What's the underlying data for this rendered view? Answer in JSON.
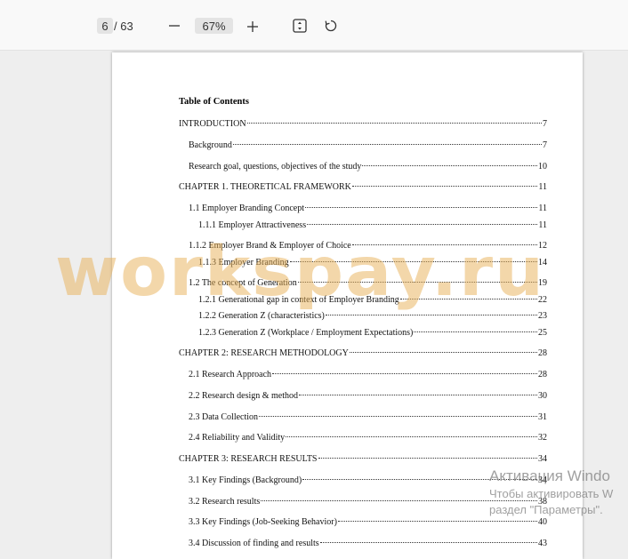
{
  "toolbar": {
    "page_current": "6",
    "page_total": "/ 63",
    "zoom": "67%",
    "icons": [
      "minus-icon",
      "plus-icon",
      "fit-page-icon",
      "rotate-icon"
    ]
  },
  "document": {
    "toc_title": "Table of Contents",
    "entries": [
      {
        "text": "INTRODUCTION",
        "page": "7"
      },
      {
        "text": "Background",
        "page": "7"
      },
      {
        "text": "Research goal, questions, objectives of the study",
        "page": "10"
      },
      {
        "text": "CHAPTER 1. THEORETICAL FRAMEWORK",
        "page": "11"
      },
      {
        "text": "1.1 Employer Branding Concept",
        "page": "11"
      },
      {
        "text": "1.1.1 Employer Attractiveness",
        "page": "11"
      },
      {
        "text": "1.1.2 Employer Brand & Employer of Choice",
        "page": "12"
      },
      {
        "text": "1.1.3 Employer Branding",
        "page": "14"
      },
      {
        "text": "1.2 The concept of Generation",
        "page": "19"
      },
      {
        "text": "1.2.1 Generational gap in context of Employer Branding",
        "page": "22"
      },
      {
        "text": "1.2.2 Generation Z (characteristics)",
        "page": "23"
      },
      {
        "text": "1.2.3 Generation Z (Workplace / Employment Expectations)",
        "page": "25"
      },
      {
        "text": "CHAPTER 2: RESEARCH METHODOLOGY",
        "page": "28"
      },
      {
        "text": "2.1 Research Approach",
        "page": "28"
      },
      {
        "text": "2.2 Research design & method",
        "page": "30"
      },
      {
        "text": "2.3 Data Collection",
        "page": "31"
      },
      {
        "text": "2.4 Reliability and Validity",
        "page": "32"
      },
      {
        "text": "CHAPTER 3: RESEARCH RESULTS",
        "page": "34"
      },
      {
        "text": "3.1 Key Findings (Background)",
        "page": "34"
      },
      {
        "text": "3.2 Research results",
        "page": "38"
      },
      {
        "text": "3.3 Key Findings (Job-Seeking Behavior)",
        "page": "40"
      },
      {
        "text": "3.4 Discussion of finding and results",
        "page": "43"
      }
    ]
  },
  "watermark": "workspay.ru",
  "activation": {
    "title": "Активация Windo",
    "line1": "Чтобы активировать W",
    "line2": "раздел \"Параметры\"."
  }
}
